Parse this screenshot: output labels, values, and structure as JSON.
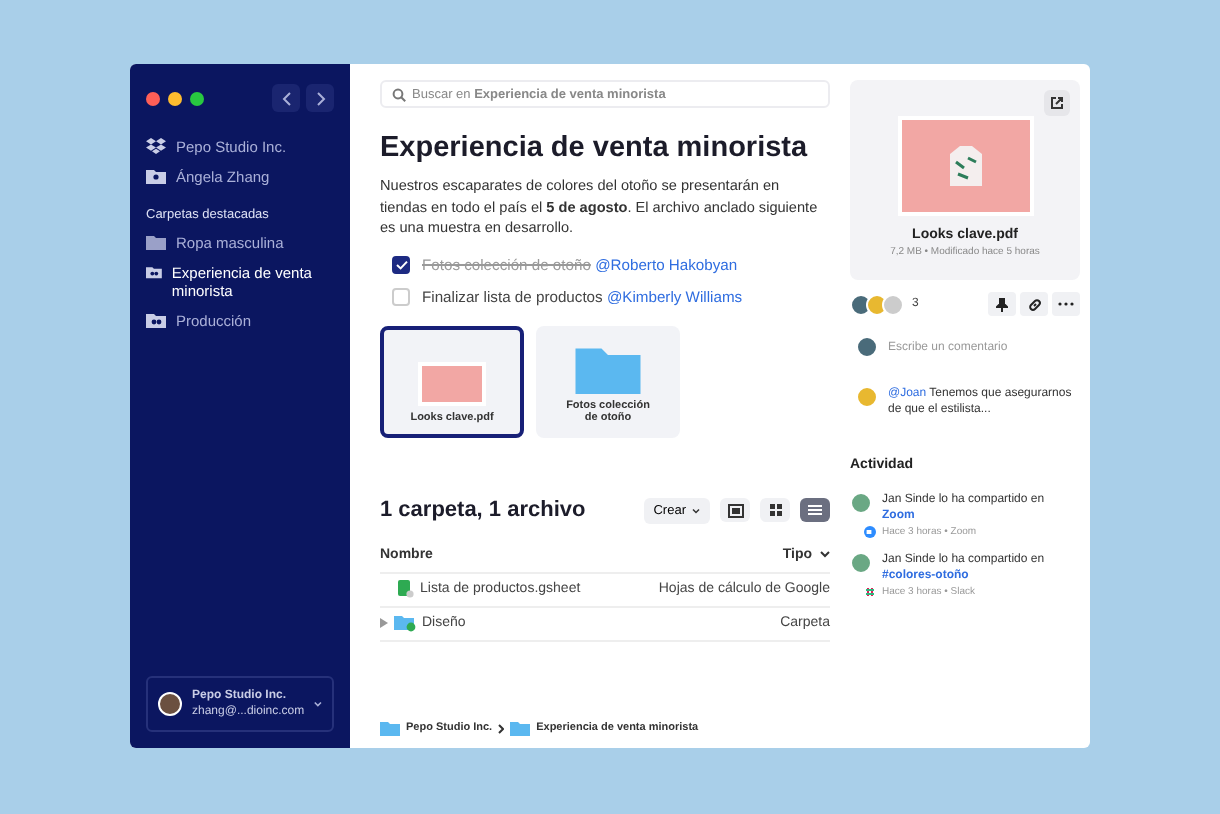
{
  "sidebar": {
    "team": "Pepo Studio Inc.",
    "user": "Ángela Zhang",
    "section": "Carpetas destacadas",
    "folders": [
      {
        "label": "Ropa masculina",
        "selected": false,
        "kind": "plain"
      },
      {
        "label": "Experiencia de venta minorista",
        "selected": true,
        "kind": "shared"
      },
      {
        "label": "Producción",
        "selected": false,
        "kind": "shared"
      }
    ],
    "account": {
      "name": "Pepo Studio Inc.",
      "email": "zhang@...dioinc.com"
    }
  },
  "search": {
    "text": "Buscar en **Experiencia de venta minorista**"
  },
  "title": "Experiencia de venta minorista",
  "description": "Nuestros escaparates de colores del otoño se presentarán en tiendas en todo el país el **5 de agosto**. El archivo anclado siguiente es una muestra en desarrollo.",
  "tasks": [
    {
      "text": "Fotos colección de otoño",
      "mention": "@Roberto Hakobyan",
      "checked": true
    },
    {
      "text": "Finalizar lista de productos",
      "mention": "@Kimberly Williams",
      "checked": false
    }
  ],
  "pinned": [
    {
      "name": "Looks clave.pdf",
      "kind": "image",
      "selected": true
    },
    {
      "name": "Fotos colección de otoño",
      "kind": "folder",
      "selected": false
    }
  ],
  "listing": {
    "heading": "1 carpeta, 1 archivo",
    "create": "Crear",
    "views": [
      {
        "kind": "preview",
        "selected": false
      },
      {
        "kind": "grid",
        "selected": false
      },
      {
        "kind": "list",
        "selected": true
      }
    ],
    "columns": [
      "Nombre",
      "Tipo"
    ],
    "rows": [
      {
        "name": "Lista de productos.gsheet",
        "type": "Hojas de cálculo de Google",
        "kind": "sheet"
      },
      {
        "name": "Diseño",
        "type": "Carpeta",
        "kind": "folder"
      }
    ]
  },
  "breadcrumb": [
    "Pepo Studio Inc.",
    "Experiencia de venta minorista"
  ],
  "preview": {
    "name": "Looks clave.pdf",
    "meta": "7,2 MB • Modificado hace 5 horas",
    "count": "3",
    "comment_placeholder": "Escribe un comentario",
    "comments": [
      {
        "mention": "@Joan",
        "text": "Tenemos que asegurarnos de que el estilista..."
      }
    ]
  },
  "activity": {
    "heading": "Actividad",
    "items": [
      {
        "text": "Jan Sinde lo ha compartido en",
        "link": "Zoom",
        "meta": "Hace 3 horas • Zoom",
        "kind": "zoom"
      },
      {
        "text": "Jan Sinde lo ha compartido en",
        "link": "#colores-otoño",
        "meta": "Hace 3 horas • Slack",
        "kind": "slack"
      }
    ]
  }
}
